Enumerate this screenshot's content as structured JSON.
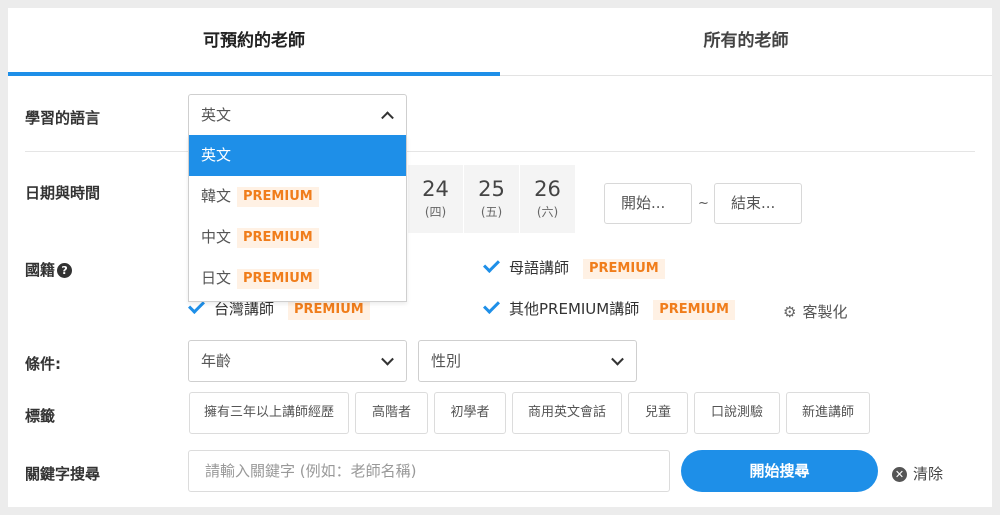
{
  "tabs": [
    {
      "label": "可預約的老師",
      "active": true
    },
    {
      "label": "所有的老師",
      "active": false
    }
  ],
  "language": {
    "label": "學習的語言",
    "selected": "英文",
    "options": [
      {
        "label": "英文",
        "badge": ""
      },
      {
        "label": "韓文",
        "badge": "PREMIUM"
      },
      {
        "label": "中文",
        "badge": "PREMIUM"
      },
      {
        "label": "日文",
        "badge": "PREMIUM"
      }
    ]
  },
  "datetime": {
    "label": "日期與時間",
    "days": [
      {
        "num": "24",
        "dow": "(四)"
      },
      {
        "num": "25",
        "dow": "(五)"
      },
      {
        "num": "26",
        "dow": "(六)"
      }
    ],
    "start_placeholder": "開始...",
    "tilde": "~",
    "end_placeholder": "結束..."
  },
  "nationality": {
    "label": "國籍",
    "help_icon": "?",
    "options": [
      {
        "label": "母語講師",
        "badge": "PREMIUM",
        "checked": true
      },
      {
        "label": "台灣講師",
        "badge": "PREMIUM",
        "checked": true
      },
      {
        "label": "其他PREMIUM講師",
        "badge": "PREMIUM",
        "checked": true
      }
    ],
    "customize": "客製化"
  },
  "conditions": {
    "label": "條件:",
    "age_placeholder": "年齡",
    "gender_placeholder": "性別"
  },
  "tags": {
    "label": "標籤",
    "items": [
      "擁有三年以上講師經歷",
      "高階者",
      "初學者",
      "商用英文會話",
      "兒童",
      "口說測驗",
      "新進講師"
    ]
  },
  "keyword": {
    "label": "關鍵字搜尋",
    "placeholder": "請輸入關鍵字 (例如：老師名稱)",
    "search_button": "開始搜尋",
    "clear_button": "清除"
  },
  "colors": {
    "accent": "#1e8fe8",
    "badge_text": "#f07d1b",
    "badge_bg": "#fff1e4"
  }
}
